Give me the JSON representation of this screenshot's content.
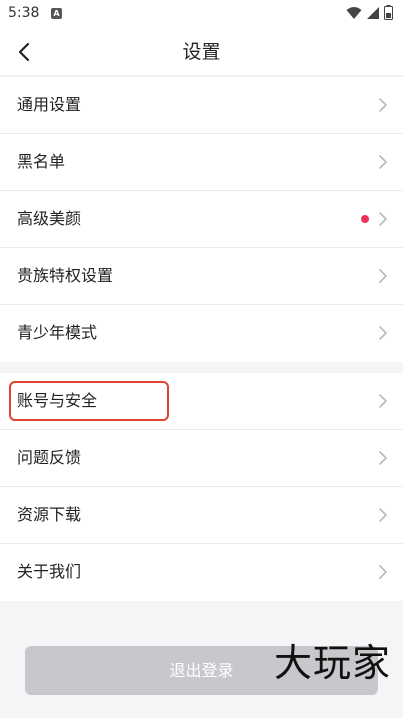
{
  "status_bar": {
    "time": "5:38",
    "app_icon_letter": "A"
  },
  "header": {
    "title": "设置"
  },
  "groups": [
    {
      "items": [
        {
          "label": "通用设置"
        },
        {
          "label": "黑名单"
        },
        {
          "label": "高级美颜",
          "badge": "red-dot"
        },
        {
          "label": "贵族特权设置"
        },
        {
          "label": "青少年模式"
        }
      ]
    },
    {
      "items": [
        {
          "label": "账号与安全",
          "highlighted": true
        },
        {
          "label": "问题反馈"
        },
        {
          "label": "资源下载"
        },
        {
          "label": "关于我们"
        }
      ]
    }
  ],
  "logout": {
    "label": "退出登录"
  },
  "watermark": {
    "text": "大玩家"
  },
  "colors": {
    "badge_red": "#f0325a",
    "highlight_border": "#e0442e",
    "logout_bg": "#c8c8cc",
    "chevron": "#b8b8b8"
  }
}
